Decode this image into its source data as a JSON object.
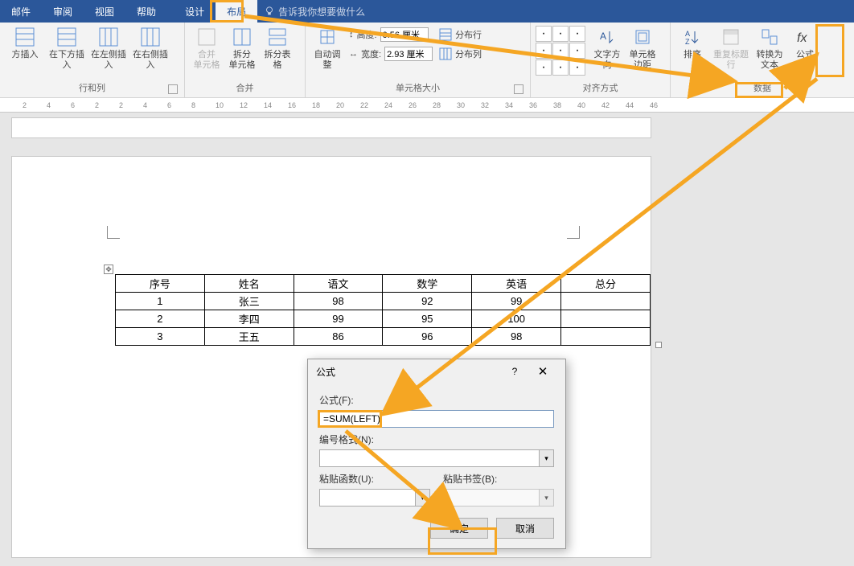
{
  "tabs": {
    "mail": "邮件",
    "review": "审阅",
    "view": "视图",
    "help": "帮助",
    "design": "设计",
    "layout": "布局"
  },
  "tell_me": "告诉我你想要做什么",
  "ribbon": {
    "rows_cols": {
      "label": "行和列",
      "insert_above": "方插入",
      "insert_below": "在下方插入",
      "insert_left": "在左侧插入",
      "insert_right": "在右侧插入"
    },
    "merge": {
      "label": "合并",
      "merge_cells": "合并\n单元格",
      "split_cells": "拆分\n单元格",
      "split_table": "拆分表格"
    },
    "cell_size": {
      "label": "单元格大小",
      "autofit": "自动调整",
      "height_label": "高度:",
      "height_value": "0.56 厘米",
      "width_label": "宽度:",
      "width_value": "2.93 厘米",
      "dist_rows": "分布行",
      "dist_cols": "分布列"
    },
    "alignment": {
      "label": "对齐方式",
      "text_dir": "文字方向",
      "cell_margin": "单元格\n边距"
    },
    "data": {
      "label": "数据",
      "sort": "排序",
      "repeat_header": "重复标题行",
      "convert": "转换为文本",
      "formula": "公式"
    }
  },
  "table": {
    "headers": [
      "序号",
      "姓名",
      "语文",
      "数学",
      "英语",
      "总分"
    ],
    "rows": [
      [
        "1",
        "张三",
        "98",
        "92",
        "99",
        ""
      ],
      [
        "2",
        "李四",
        "99",
        "95",
        "100",
        ""
      ],
      [
        "3",
        "王五",
        "86",
        "96",
        "98",
        ""
      ]
    ]
  },
  "dialog": {
    "title": "公式",
    "help": "?",
    "formula_label": "公式(F):",
    "formula_value": "=SUM(LEFT)",
    "number_format_label": "编号格式(N):",
    "paste_function_label": "粘贴函数(U):",
    "paste_bookmark_label": "粘贴书签(B):",
    "ok": "确定",
    "cancel": "取消"
  },
  "ruler_marks": [
    "2",
    "4",
    "6",
    "2",
    "2",
    "4",
    "6",
    "8",
    "10",
    "12",
    "14",
    "16",
    "18",
    "20",
    "22",
    "24",
    "26",
    "28",
    "30",
    "32",
    "34",
    "36",
    "38",
    "40",
    "42",
    "44",
    "46"
  ]
}
